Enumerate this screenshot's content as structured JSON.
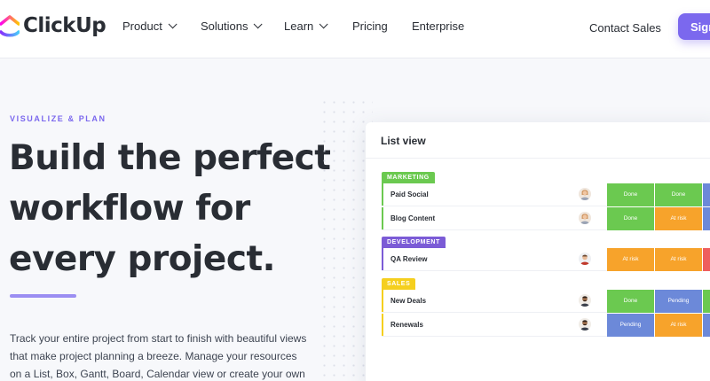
{
  "nav": {
    "logo_text": "ClickUp",
    "items": [
      {
        "label": "Product",
        "has_menu": true
      },
      {
        "label": "Solutions",
        "has_menu": true
      },
      {
        "label": "Learn",
        "has_menu": true
      },
      {
        "label": "Pricing",
        "has_menu": false
      },
      {
        "label": "Enterprise",
        "has_menu": false
      }
    ],
    "contact_label": "Contact Sales",
    "signup_label": "Sign"
  },
  "hero": {
    "eyebrow": "VISUALIZE & PLAN",
    "headline_lines": [
      "Build the perfect",
      "workflow for",
      "every project."
    ],
    "description": "Track your entire project from start to finish with beautiful views that make project planning a breeze. Manage your resources on a List, Box, Gantt, Board, Calendar view or create your own"
  },
  "list_view": {
    "title": "List view",
    "groups": [
      {
        "name": "MARKETING",
        "color": "#6bc950",
        "rows": [
          {
            "task": "Paid Social",
            "avatar": "avatar-woman",
            "status1": {
              "label": "Done",
              "color": "#6bc950"
            },
            "status2": {
              "label": "Done",
              "color": "#6bc950"
            },
            "status3": {
              "label": "",
              "color": "#6c89d9"
            }
          },
          {
            "task": "Blog Content",
            "avatar": "avatar-woman",
            "status1": {
              "label": "Done",
              "color": "#6bc950"
            },
            "status2": {
              "label": "At risk",
              "color": "#f7a32b"
            },
            "status3": {
              "label": "",
              "color": "#6c89d9"
            }
          }
        ]
      },
      {
        "name": "DEVELOPMENT",
        "color": "#7b5bd6",
        "rows": [
          {
            "task": "QA Review",
            "avatar": "avatar-man",
            "status1": {
              "label": "At risk",
              "color": "#f7a32b"
            },
            "status2": {
              "label": "At risk",
              "color": "#f7a32b"
            },
            "status3": {
              "label": "",
              "color": "#ee5e5e"
            }
          }
        ]
      },
      {
        "name": "SALES",
        "color": "#f5cf1e",
        "rows": [
          {
            "task": "New Deals",
            "avatar": "avatar-man-dark",
            "status1": {
              "label": "Done",
              "color": "#6bc950"
            },
            "status2": {
              "label": "Pending",
              "color": "#6c89d9"
            },
            "status3": {
              "label": "",
              "color": "#6bc950"
            }
          },
          {
            "task": "Renewals",
            "avatar": "avatar-man-dark",
            "status1": {
              "label": "Pending",
              "color": "#6c89d9"
            },
            "status2": {
              "label": "At risk",
              "color": "#f7a32b"
            },
            "status3": {
              "label": "",
              "color": "#6c89d9"
            }
          }
        ]
      }
    ]
  }
}
